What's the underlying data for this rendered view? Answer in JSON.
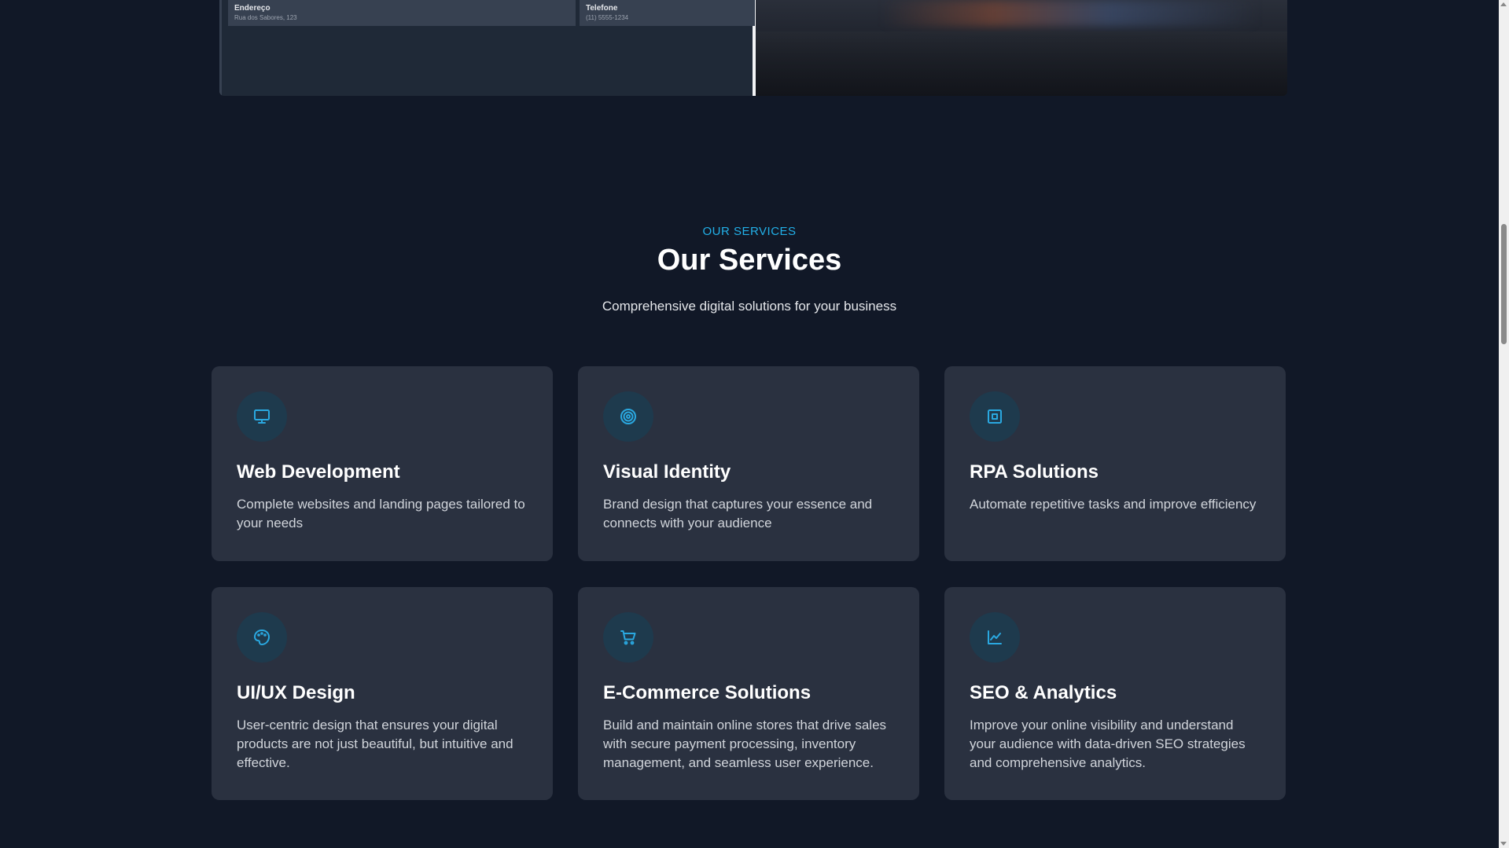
{
  "preview": {
    "address_label": "Endereço",
    "address_value": "Rua dos Sabores, 123",
    "phone_label": "Telefone",
    "phone_value": "(11) 5555-1234"
  },
  "services": {
    "eyebrow": "OUR SERVICES",
    "title": "Our Services",
    "subtitle": "Comprehensive digital solutions for your business",
    "accent_color": "#22b0e8",
    "items": [
      {
        "icon": "monitor-icon",
        "title": "Web Development",
        "description": "Complete websites and landing pages tailored to your needs"
      },
      {
        "icon": "target-icon",
        "title": "Visual Identity",
        "description": "Brand design that captures your essence and connects with your audience"
      },
      {
        "icon": "cpu-icon",
        "title": "RPA Solutions",
        "description": "Automate repetitive tasks and improve efficiency"
      },
      {
        "icon": "palette-icon",
        "title": "UI/UX Design",
        "description": "User-centric design that ensures your digital products are not just beautiful, but intuitive and effective."
      },
      {
        "icon": "shopping-cart-icon",
        "title": "E-Commerce Solutions",
        "description": "Build and maintain online stores that drive sales with secure payment processing, inventory management, and seamless user experience."
      },
      {
        "icon": "line-chart-icon",
        "title": "SEO & Analytics",
        "description": "Improve your online visibility and understand your audience with data-driven SEO strategies and comprehensive analytics."
      }
    ]
  }
}
